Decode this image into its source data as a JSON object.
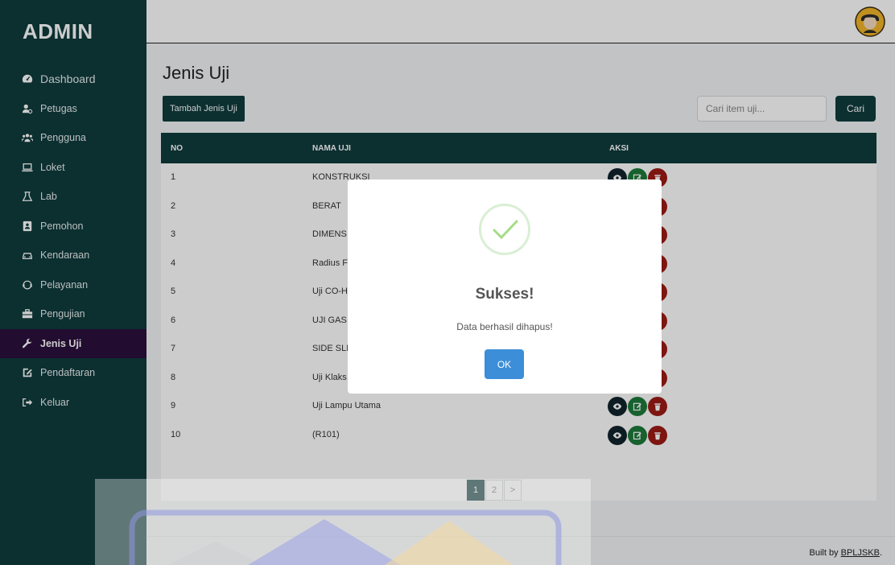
{
  "sidebar": {
    "brand": "ADMIN",
    "items": [
      {
        "label": "Dashboard",
        "icon": "dashboard-icon"
      },
      {
        "label": "Petugas",
        "icon": "users-icon"
      },
      {
        "label": "Pengguna",
        "icon": "user-group-icon"
      },
      {
        "label": "Loket",
        "icon": "laptop-icon"
      },
      {
        "label": "Lab",
        "icon": "flask-icon"
      },
      {
        "label": "Pemohon",
        "icon": "contact-book-icon"
      },
      {
        "label": "Kendaraan",
        "icon": "car-icon"
      },
      {
        "label": "Pelayanan",
        "icon": "headset-icon"
      },
      {
        "label": "Pengujian",
        "icon": "toolbox-icon"
      },
      {
        "label": "Jenis Uji",
        "icon": "wrench-icon",
        "active": true
      },
      {
        "label": "Pendaftaran",
        "icon": "edit-document-icon"
      },
      {
        "label": "Keluar",
        "icon": "sign-out-icon"
      }
    ]
  },
  "header": {
    "page_title": "Jenis Uji",
    "add_button": "Tambah Jenis Uji",
    "search_placeholder": "Cari item uji...",
    "search_button": "Cari"
  },
  "table": {
    "columns": [
      "NO",
      "NAMA UJI",
      "AKSI"
    ],
    "rows": [
      {
        "no": "1",
        "nama": "KONSTRUKSI"
      },
      {
        "no": "2",
        "nama": "BERAT"
      },
      {
        "no": "3",
        "nama": "DIMENS"
      },
      {
        "no": "4",
        "nama": "Radius F"
      },
      {
        "no": "5",
        "nama": "Uji CO-H"
      },
      {
        "no": "6",
        "nama": "UJI GAS"
      },
      {
        "no": "7",
        "nama": "SIDE SLI"
      },
      {
        "no": "8",
        "nama": "Uji Klaks"
      },
      {
        "no": "9",
        "nama": "Uji Lampu Utama"
      },
      {
        "no": "10",
        "nama": "(R101)"
      }
    ]
  },
  "pagination": {
    "pages": [
      "1",
      "2"
    ],
    "next": ">",
    "current": "1"
  },
  "footer": {
    "prefix": "Built by ",
    "link": "BPLJSKB",
    "suffix": "."
  },
  "modal": {
    "title": "Sukses!",
    "message": "Data berhasil dihapus!",
    "ok_label": "OK"
  },
  "colors": {
    "sidebar_bg": "#0f3b3d",
    "active_item_bg": "#2b0f3d",
    "ok_button": "#3c8ed8",
    "view_button": "#11232b",
    "edit_button": "#1d7a3a",
    "delete_button": "#9d1b14",
    "success_check": "#a5dc86"
  }
}
